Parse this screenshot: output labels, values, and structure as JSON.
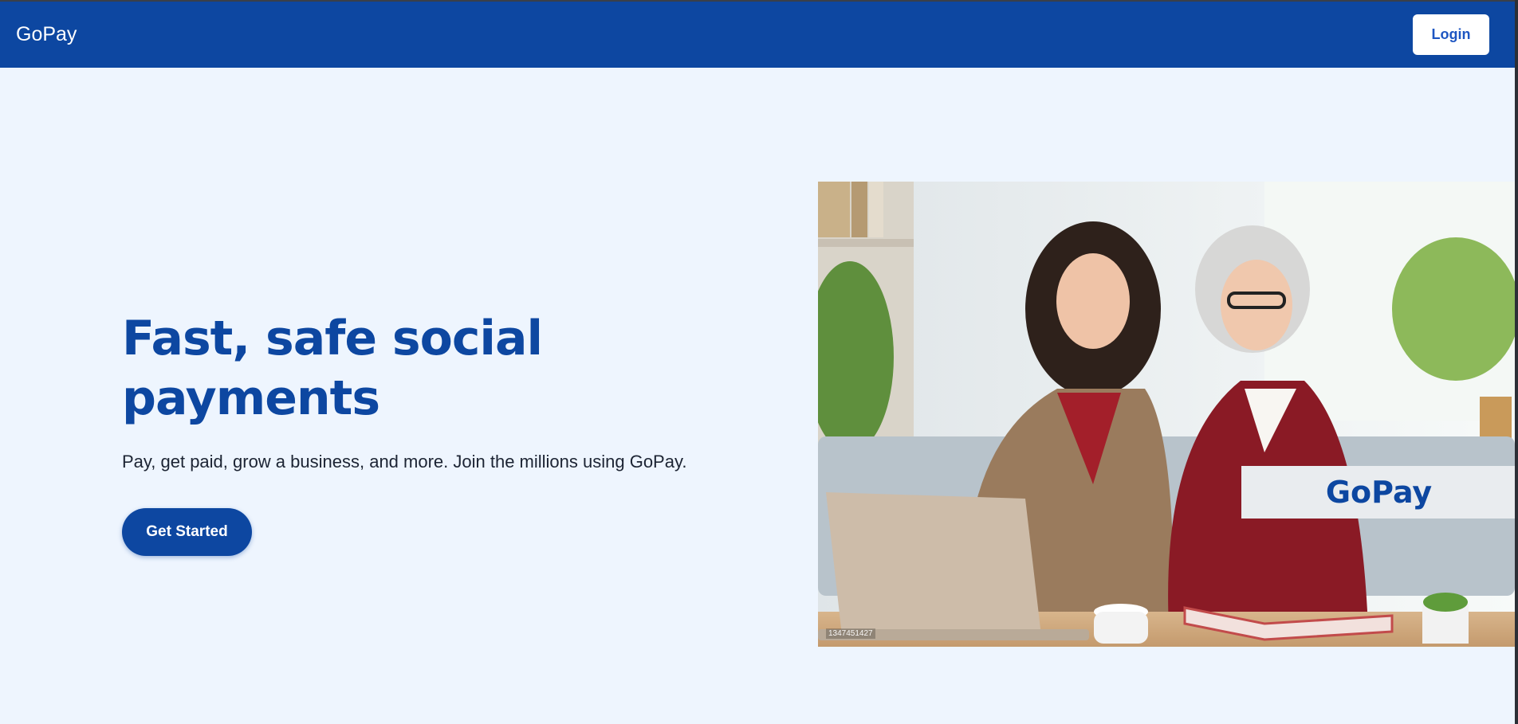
{
  "navbar": {
    "brand": "GoPay",
    "login_label": "Login",
    "background_color": "#0d47a1"
  },
  "hero": {
    "title": "Fast, safe social payments",
    "subtitle": "Pay, get paid, grow a business, and more. Join the millions using GoPay.",
    "cta_label": "Get Started",
    "image": {
      "badge_text": "GoPay",
      "stock_id": "1347451427"
    }
  },
  "colors": {
    "brand": "#0d47a1",
    "page_background": "#eef5fe",
    "badge_background": "#e9ecef"
  }
}
